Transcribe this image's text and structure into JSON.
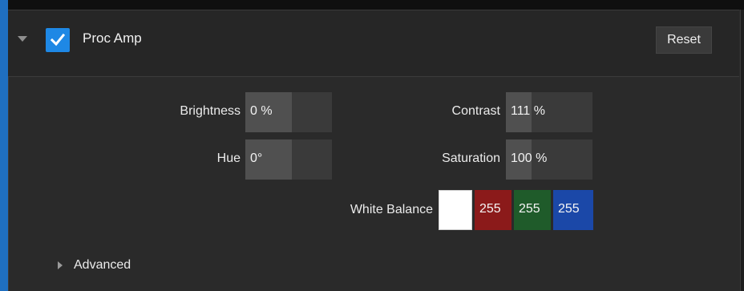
{
  "header": {
    "title": "Proc Amp",
    "enabled": true,
    "reset_label": "Reset"
  },
  "fields": {
    "brightness": {
      "label": "Brightness",
      "value": "0 %"
    },
    "contrast": {
      "label": "Contrast",
      "value": "111 %"
    },
    "hue": {
      "label": "Hue",
      "value": "0°"
    },
    "saturation": {
      "label": "Saturation",
      "value": "100 %"
    }
  },
  "white_balance": {
    "label": "White Balance",
    "preview_color": "#ffffff",
    "r": "255",
    "g": "255",
    "b": "255",
    "r_color": "#8b1a1a",
    "g_color": "#1f5b2a",
    "b_color": "#1b48a8"
  },
  "advanced": {
    "label": "Advanced"
  },
  "colors": {
    "accent": "#1e88e5"
  }
}
